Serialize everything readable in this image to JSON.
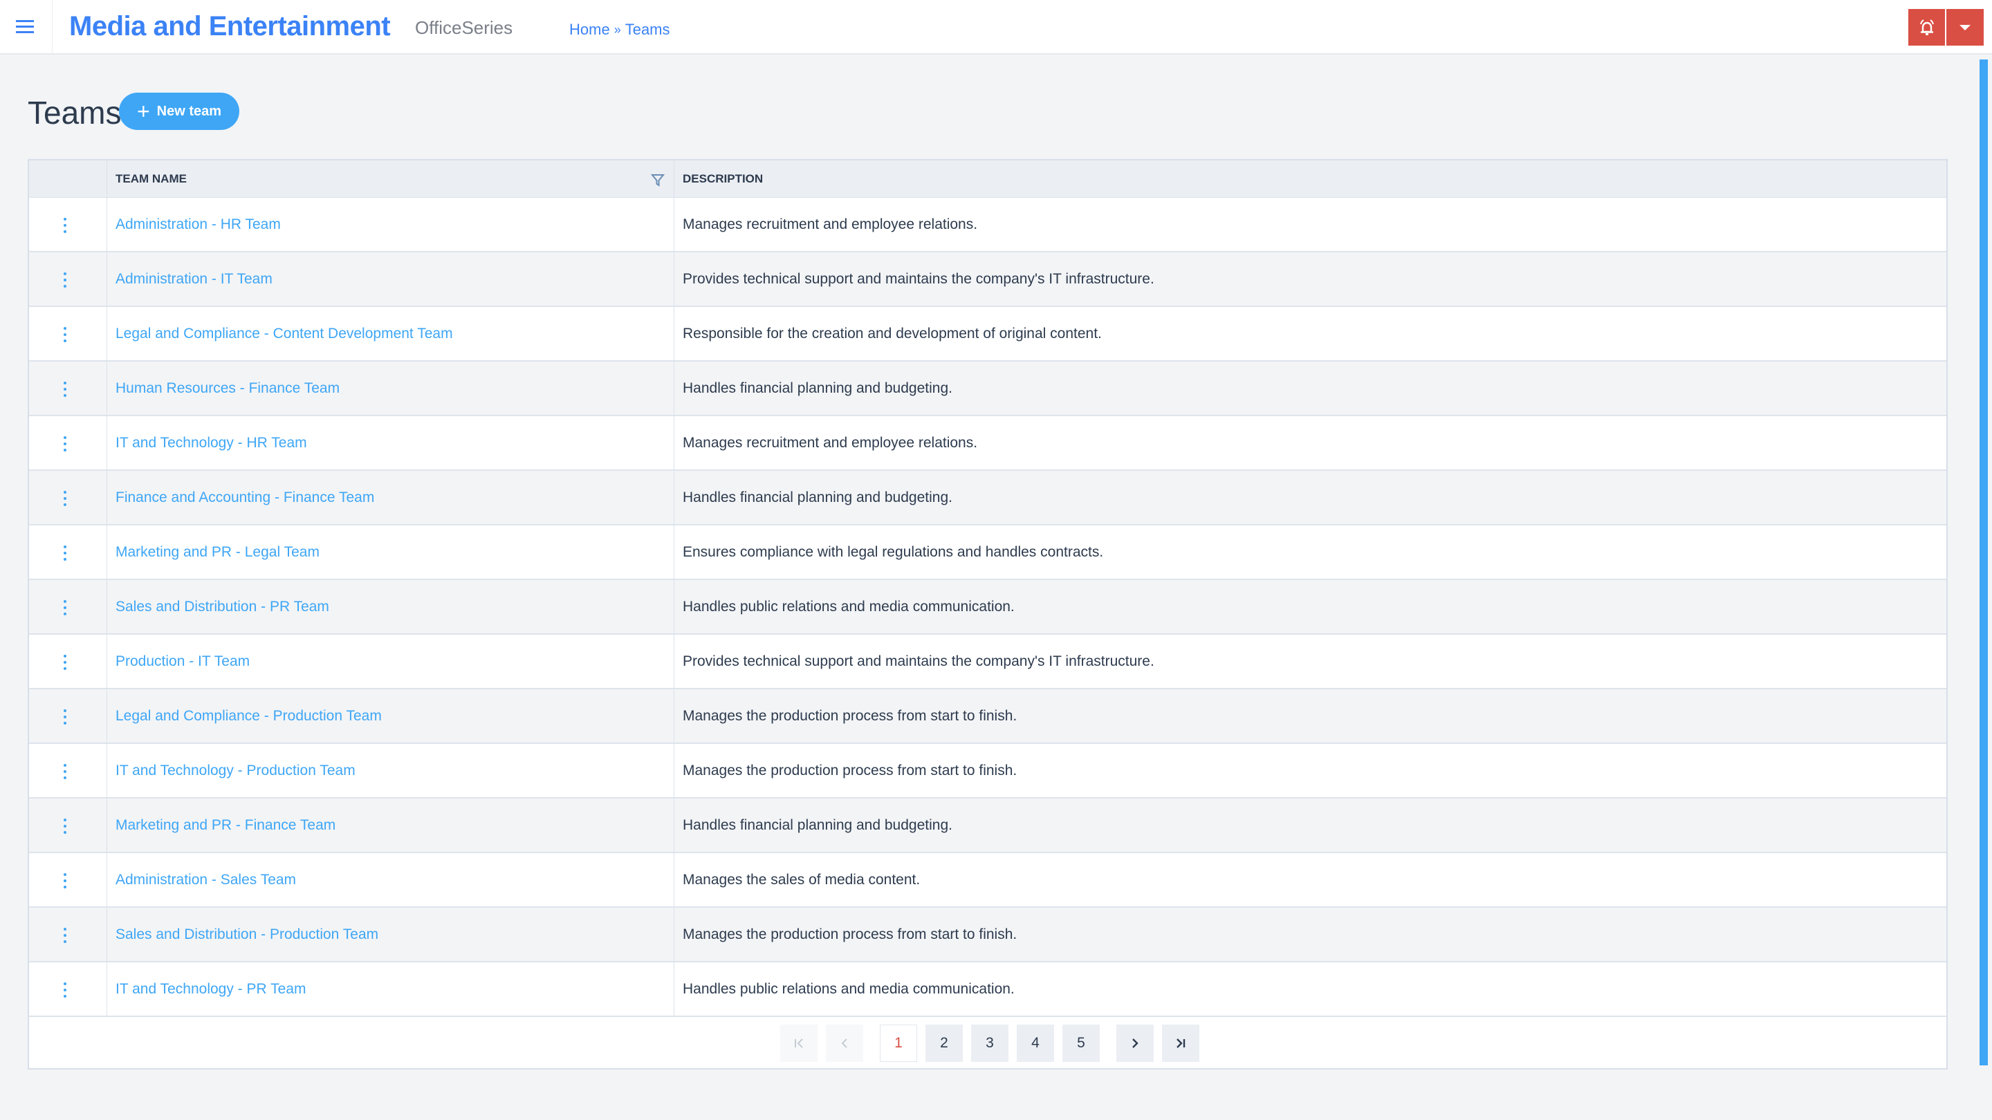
{
  "header": {
    "menu_icon": "hamburger-menu-icon",
    "app_title": "Media and Entertainment",
    "app_subtitle": "OfficeSeries",
    "breadcrumb": [
      {
        "label": "Home"
      },
      {
        "separator": "»"
      },
      {
        "label": "Teams"
      }
    ],
    "alert_icon": "bell-alarm-icon",
    "dropdown_icon": "caret-down-icon",
    "accent_color": "#3b82f6",
    "alert_color": "#d94f43"
  },
  "page": {
    "title": "Teams",
    "new_button_label": "New team",
    "new_button_icon": "plus-icon"
  },
  "table": {
    "columns": [
      "",
      "TEAM NAME",
      "DESCRIPTION"
    ],
    "filter_icon": "filter-icon",
    "row_action_icon": "kebab-menu-icon",
    "rows": [
      {
        "name": "Administration - HR Team",
        "description": "Manages recruitment and employee relations."
      },
      {
        "name": "Administration - IT Team",
        "description": "Provides technical support and maintains the company's IT infrastructure."
      },
      {
        "name": "Legal and Compliance - Content Development Team",
        "description": "Responsible for the creation and development of original content."
      },
      {
        "name": "Human Resources - Finance Team",
        "description": "Handles financial planning and budgeting."
      },
      {
        "name": "IT and Technology - HR Team",
        "description": "Manages recruitment and employee relations."
      },
      {
        "name": "Finance and Accounting - Finance Team",
        "description": "Handles financial planning and budgeting."
      },
      {
        "name": "Marketing and PR - Legal Team",
        "description": "Ensures compliance with legal regulations and handles contracts."
      },
      {
        "name": "Sales and Distribution - PR Team",
        "description": "Handles public relations and media communication."
      },
      {
        "name": "Production - IT Team",
        "description": "Provides technical support and maintains the company's IT infrastructure."
      },
      {
        "name": "Legal and Compliance - Production Team",
        "description": "Manages the production process from start to finish."
      },
      {
        "name": "IT and Technology - Production Team",
        "description": "Manages the production process from start to finish."
      },
      {
        "name": "Marketing and PR - Finance Team",
        "description": "Handles financial planning and budgeting."
      },
      {
        "name": "Administration - Sales Team",
        "description": "Manages the sales of media content."
      },
      {
        "name": "Sales and Distribution - Production Team",
        "description": "Manages the production process from start to finish."
      },
      {
        "name": "IT and Technology - PR Team",
        "description": "Handles public relations and media communication."
      }
    ]
  },
  "pagination": {
    "first_icon": "first-page-icon",
    "prev_icon": "previous-page-icon",
    "next_icon": "next-page-icon",
    "last_icon": "last-page-icon",
    "pages": [
      "1",
      "2",
      "3",
      "4",
      "5"
    ],
    "current_page": "1"
  }
}
